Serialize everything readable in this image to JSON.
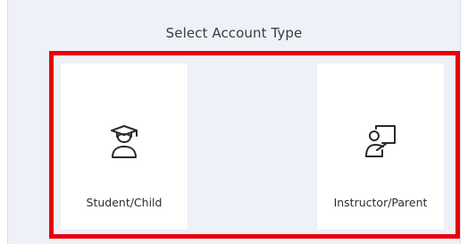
{
  "header": {
    "title": "Select Account Type"
  },
  "account_types": [
    {
      "label": "Student/Child",
      "icon": "graduation-cap-student-icon"
    },
    {
      "label": "Instructor/Parent",
      "icon": "teacher-at-board-icon"
    }
  ],
  "colors": {
    "panel_background": "#eef2f8",
    "card_background": "#ffffff",
    "highlight_border": "#e8000b",
    "text": "#2e2e2e"
  }
}
